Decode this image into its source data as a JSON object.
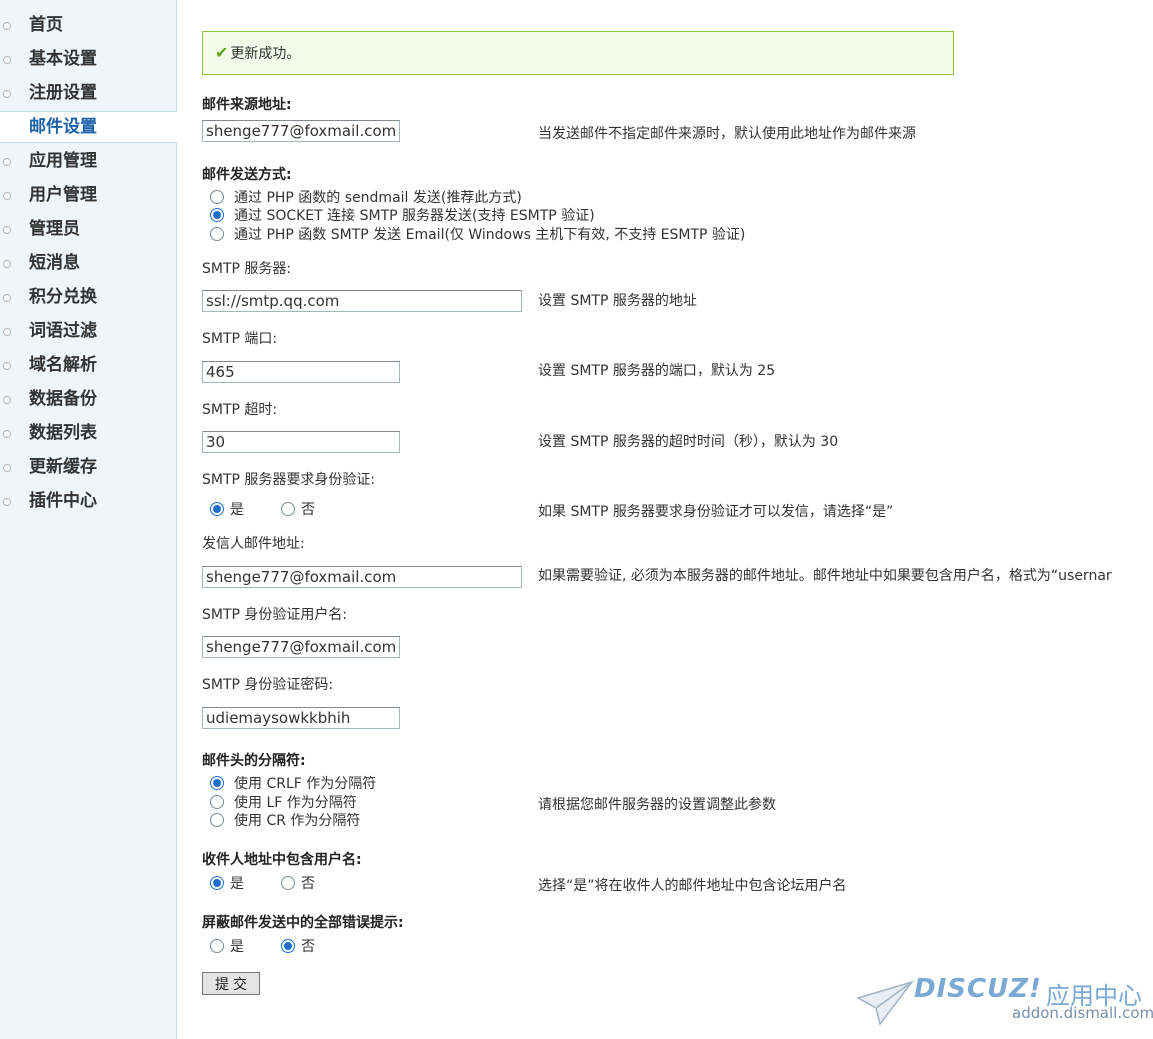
{
  "sidebar": {
    "items": [
      {
        "label": "首页",
        "active": false
      },
      {
        "label": "基本设置",
        "active": false
      },
      {
        "label": "注册设置",
        "active": false
      },
      {
        "label": "邮件设置",
        "active": true
      },
      {
        "label": "应用管理",
        "active": false
      },
      {
        "label": "用户管理",
        "active": false
      },
      {
        "label": "管理员",
        "active": false
      },
      {
        "label": "短消息",
        "active": false
      },
      {
        "label": "积分兑换",
        "active": false
      },
      {
        "label": "词语过滤",
        "active": false
      },
      {
        "label": "域名解析",
        "active": false
      },
      {
        "label": "数据备份",
        "active": false
      },
      {
        "label": "数据列表",
        "active": false
      },
      {
        "label": "更新缓存",
        "active": false
      },
      {
        "label": "插件中心",
        "active": false
      }
    ]
  },
  "message": {
    "icon": "check-icon",
    "text": "更新成功。"
  },
  "form": {
    "mail_from": {
      "label": "邮件来源地址:",
      "value": "shenge777@foxmail.com",
      "tip": "当发送邮件不指定邮件来源时，默认使用此地址作为邮件来源"
    },
    "mail_method": {
      "label": "邮件发送方式:",
      "options": [
        {
          "label": "通过 PHP 函数的 sendmail 发送(推荐此方式)",
          "checked": false
        },
        {
          "label": "通过 SOCKET 连接 SMTP 服务器发送(支持 ESMTP 验证)",
          "checked": true
        },
        {
          "label": "通过 PHP 函数 SMTP 发送 Email(仅 Windows 主机下有效, 不支持 ESMTP 验证)",
          "checked": false
        }
      ]
    },
    "smtp_server": {
      "label": "SMTP 服务器:",
      "value": "ssl://smtp.qq.com",
      "tip": "设置 SMTP 服务器的地址"
    },
    "smtp_port": {
      "label": "SMTP 端口:",
      "value": "465",
      "tip": "设置 SMTP 服务器的端口，默认为 25"
    },
    "smtp_timeout": {
      "label": "SMTP 超时:",
      "value": "30",
      "tip": "设置 SMTP 服务器的超时时间（秒），默认为 30"
    },
    "smtp_auth": {
      "label": "SMTP 服务器要求身份验证:",
      "yes": "是",
      "no": "否",
      "value": "yes",
      "tip": "如果 SMTP 服务器要求身份验证才可以发信，请选择“是”"
    },
    "sender_address": {
      "label": "发信人邮件地址:",
      "value": "shenge777@foxmail.com",
      "tip": "如果需要验证, 必须为本服务器的邮件地址。邮件地址中如果要包含用户名，格式为“usernar"
    },
    "auth_username": {
      "label": "SMTP 身份验证用户名:",
      "value": "shenge777@foxmail.com"
    },
    "auth_password": {
      "label": "SMTP 身份验证密码:",
      "value": "udiemaysowkkbhih"
    },
    "header_separator": {
      "label": "邮件头的分隔符:",
      "options": [
        {
          "label": "使用 CRLF 作为分隔符",
          "checked": true
        },
        {
          "label": "使用 LF 作为分隔符",
          "checked": false
        },
        {
          "label": "使用 CR 作为分隔符",
          "checked": false
        }
      ],
      "tip": "请根据您邮件服务器的设置调整此参数"
    },
    "include_username": {
      "label": "收件人地址中包含用户名:",
      "yes": "是",
      "no": "否",
      "value": "yes",
      "tip": "选择“是”将在收件人的邮件地址中包含论坛用户名"
    },
    "silent_errors": {
      "label": "屏蔽邮件发送中的全部错误提示:",
      "yes": "是",
      "no": "否",
      "value": "no"
    },
    "submit_label": "提交"
  },
  "watermark": {
    "brand": "DISCUZ!",
    "center": "应用中心",
    "domain": "addon.dismall.com"
  }
}
